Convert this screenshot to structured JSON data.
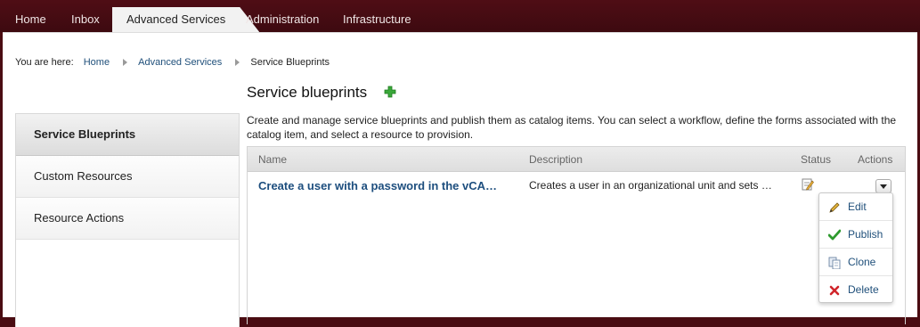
{
  "nav": {
    "tabs": [
      {
        "label": "Home"
      },
      {
        "label": "Inbox"
      },
      {
        "label": "Advanced Services"
      },
      {
        "label": "Administration"
      },
      {
        "label": "Infrastructure"
      }
    ],
    "active_tab": "Advanced Services"
  },
  "breadcrumb": {
    "prefix": "You are here:",
    "items": [
      "Home",
      "Advanced Services",
      "Service Blueprints"
    ]
  },
  "sidebar": {
    "items": [
      {
        "label": "Service Blueprints"
      },
      {
        "label": "Custom Resources"
      },
      {
        "label": "Resource Actions"
      }
    ],
    "active": "Service Blueprints"
  },
  "page": {
    "title": "Service blueprints",
    "add_icon": "green-plus-icon",
    "description": "Create and manage service blueprints and publish them as catalog items. You can select a workflow, define the forms associated with the catalog item, and select a resource to provision."
  },
  "table": {
    "columns": [
      "Name",
      "Description",
      "Status",
      "Actions"
    ],
    "rows": [
      {
        "name": "Create a user with a password in the vCA…",
        "description": "Creates a user in an organizational unit and sets …",
        "status_icon": "draft-edit-icon"
      }
    ]
  },
  "actions_menu": {
    "items": [
      {
        "label": "Edit",
        "icon": "pencil-icon"
      },
      {
        "label": "Publish",
        "icon": "checkmark-icon"
      },
      {
        "label": "Clone",
        "icon": "copy-icon"
      },
      {
        "label": "Delete",
        "icon": "red-x-icon"
      }
    ]
  },
  "colors": {
    "header_bg": "#4a0c12",
    "link": "#1f4f7a",
    "add_green": "#3aa83a",
    "delete_red": "#d0242a"
  }
}
